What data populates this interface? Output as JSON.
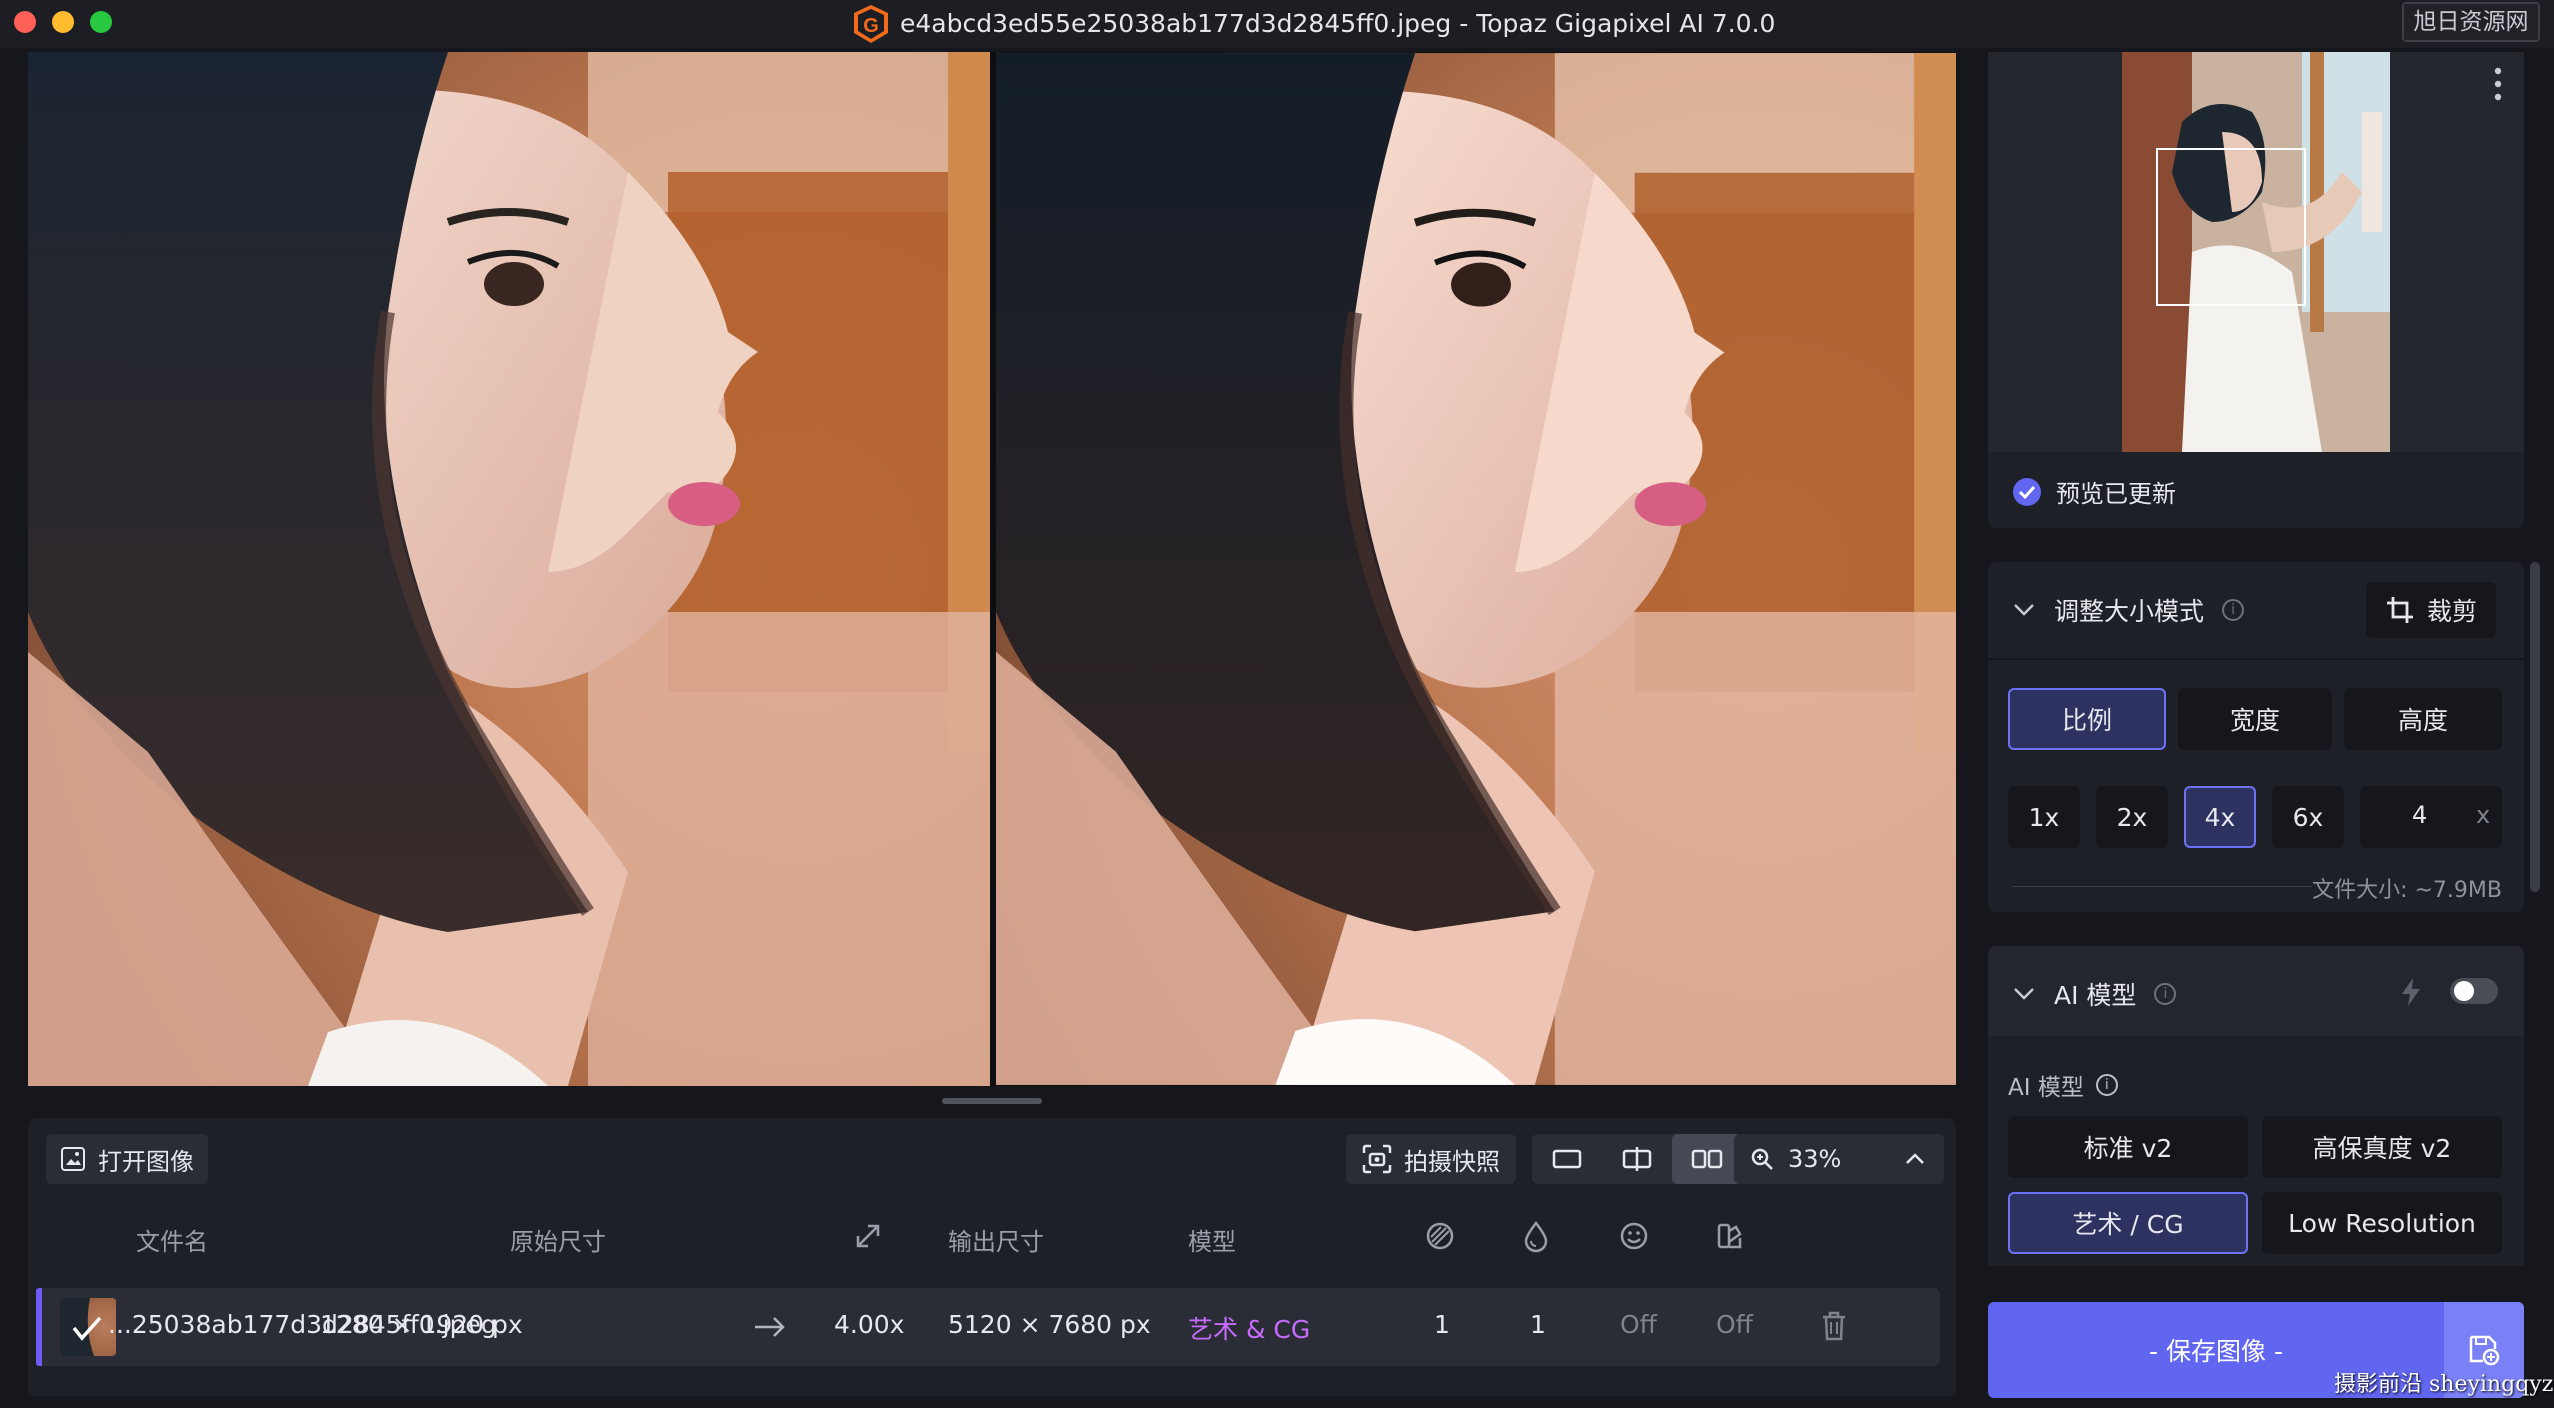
{
  "window": {
    "title": "e4abcd3ed55e25038ab177d3d2845ff0.jpeg - Topaz Gigapixel AI 7.0.0",
    "watermark_top": "旭日资源网",
    "watermark_bottom": "摄影前沿 sheyingqyz.com"
  },
  "toolbar": {
    "open_label": "打开图像",
    "snapshot_label": "拍摄快照",
    "zoom_value": "33%",
    "view_modes": [
      "single-view-icon",
      "split-view-icon",
      "side-by-side-icon"
    ],
    "active_view": "side-by-side-icon"
  },
  "file_table": {
    "headers": {
      "filename": "文件名",
      "original_size": "原始尺寸",
      "output_size": "输出尺寸",
      "model": "模型"
    },
    "row": {
      "filename": "...25038ab177d3d2845ff0.jpeg",
      "original_size": "1280 × 1920 px",
      "scale": "4.00x",
      "output_size": "5120 × 7680 px",
      "model": "艺术 & CG",
      "param1": "1",
      "param2": "1",
      "param3": "Off",
      "param4": "Off"
    }
  },
  "navigator": {
    "status": "预览已更新"
  },
  "resize": {
    "title": "调整大小模式",
    "crop_label": "裁剪",
    "modes": [
      "比例",
      "宽度",
      "高度"
    ],
    "active_mode": "比例",
    "scales": [
      "1x",
      "2x",
      "4x",
      "6x"
    ],
    "active_scale": "4x",
    "custom_value": "4",
    "custom_suffix": "x",
    "file_size": "文件大小: ~7.9MB"
  },
  "ai_model": {
    "title": "AI 模型",
    "subtitle": "AI 模型",
    "toggle_on": false,
    "models": [
      "标准 v2",
      "高保真度 v2",
      "艺术 / CG",
      "Low Resolution"
    ],
    "active_model": "艺术 / CG"
  },
  "save": {
    "label": "- 保存图像 -"
  },
  "colors": {
    "accent": "#6066f0",
    "active_border": "#6b72f5",
    "model_purple": "#c86bff",
    "panel": "#1e2027",
    "background": "#15171d"
  }
}
